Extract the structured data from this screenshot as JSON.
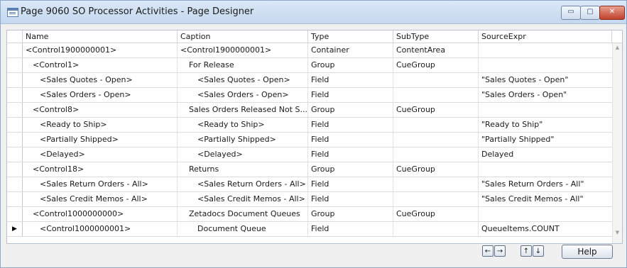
{
  "window": {
    "title": "Page 9060 SO Processor Activities - Page Designer",
    "min_glyph": "▭",
    "max_glyph": "▢",
    "close_glyph": "✕"
  },
  "grid": {
    "columns": [
      "Name",
      "Caption",
      "Type",
      "SubType",
      "SourceExpr"
    ],
    "rows": [
      {
        "indent": 0,
        "cap_indent": 0,
        "name": "<Control1900000001>",
        "caption": "<Control1900000001>",
        "type": "Container",
        "subtype": "ContentArea",
        "source": "",
        "selected": false
      },
      {
        "indent": 1,
        "cap_indent": 1,
        "name": "<Control1>",
        "caption": "For Release",
        "type": "Group",
        "subtype": "CueGroup",
        "source": "",
        "selected": false
      },
      {
        "indent": 2,
        "cap_indent": 2,
        "name": "<Sales Quotes - Open>",
        "caption": "<Sales Quotes - Open>",
        "type": "Field",
        "subtype": "",
        "source": "\"Sales Quotes - Open\"",
        "selected": false
      },
      {
        "indent": 2,
        "cap_indent": 2,
        "name": "<Sales Orders - Open>",
        "caption": "<Sales Orders - Open>",
        "type": "Field",
        "subtype": "",
        "source": "\"Sales Orders - Open\"",
        "selected": false
      },
      {
        "indent": 1,
        "cap_indent": 1,
        "name": "<Control8>",
        "caption": "Sales Orders Released Not S...",
        "type": "Group",
        "subtype": "CueGroup",
        "source": "",
        "selected": false
      },
      {
        "indent": 2,
        "cap_indent": 2,
        "name": "<Ready to Ship>",
        "caption": "<Ready to Ship>",
        "type": "Field",
        "subtype": "",
        "source": "\"Ready to Ship\"",
        "selected": false
      },
      {
        "indent": 2,
        "cap_indent": 2,
        "name": "<Partially Shipped>",
        "caption": "<Partially Shipped>",
        "type": "Field",
        "subtype": "",
        "source": "\"Partially Shipped\"",
        "selected": false
      },
      {
        "indent": 2,
        "cap_indent": 2,
        "name": "<Delayed>",
        "caption": "<Delayed>",
        "type": "Field",
        "subtype": "",
        "source": "Delayed",
        "selected": false
      },
      {
        "indent": 1,
        "cap_indent": 1,
        "name": "<Control18>",
        "caption": "Returns",
        "type": "Group",
        "subtype": "CueGroup",
        "source": "",
        "selected": false
      },
      {
        "indent": 2,
        "cap_indent": 2,
        "name": "<Sales Return Orders - All>",
        "caption": "<Sales Return Orders - All>",
        "type": "Field",
        "subtype": "",
        "source": "\"Sales Return Orders - All\"",
        "selected": false
      },
      {
        "indent": 2,
        "cap_indent": 2,
        "name": "<Sales Credit Memos - All>",
        "caption": "<Sales Credit Memos - All>",
        "type": "Field",
        "subtype": "",
        "source": "\"Sales Credit Memos - All\"",
        "selected": false
      },
      {
        "indent": 1,
        "cap_indent": 1,
        "name": "<Control1000000000>",
        "caption": "Zetadocs Document Queues",
        "type": "Group",
        "subtype": "CueGroup",
        "source": "",
        "selected": false
      },
      {
        "indent": 2,
        "cap_indent": 2,
        "name": "<Control1000000001>",
        "caption": "Document Queue",
        "type": "Field",
        "subtype": "",
        "source": "QueueItems.COUNT",
        "selected": true
      }
    ],
    "selected_marker": "▶",
    "scroll_up_glyph": "▲",
    "scroll_down_glyph": "▼"
  },
  "footer": {
    "nav_left_glyph": "←",
    "nav_right_glyph": "→",
    "nav_up_glyph": "↑",
    "nav_down_glyph": "↓",
    "help_label": "Help"
  }
}
